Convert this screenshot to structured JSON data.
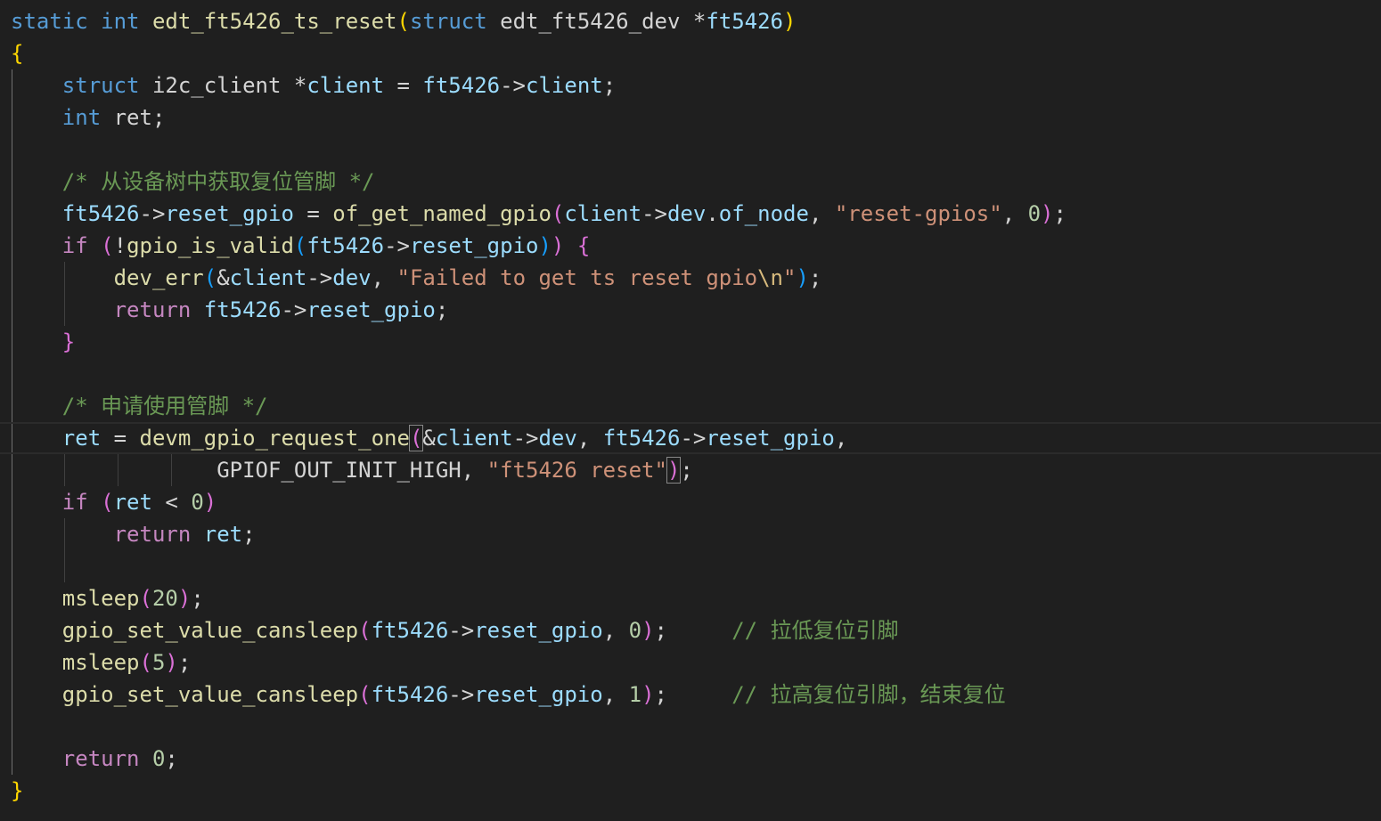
{
  "editor": {
    "theme_background": "#1f1f1f",
    "lines": [
      [
        [
          "k",
          "static"
        ],
        [
          "p",
          " "
        ],
        [
          "k",
          "int"
        ],
        [
          "p",
          " "
        ],
        [
          "f",
          "edt_ft5426_ts_reset"
        ],
        [
          "b1",
          "("
        ],
        [
          "k",
          "struct"
        ],
        [
          "p",
          " edt_ft5426_dev *"
        ],
        [
          "v",
          "ft5426"
        ],
        [
          "b1",
          ")"
        ]
      ],
      [
        [
          "b1",
          "{"
        ]
      ],
      [
        [
          "p",
          "    "
        ],
        [
          "k",
          "struct"
        ],
        [
          "p",
          " i2c_client *"
        ],
        [
          "v",
          "client"
        ],
        [
          "p",
          " = "
        ],
        [
          "v",
          "ft5426"
        ],
        [
          "p",
          "->"
        ],
        [
          "v",
          "client"
        ],
        [
          "p",
          ";"
        ]
      ],
      [
        [
          "p",
          "    "
        ],
        [
          "k",
          "int"
        ],
        [
          "p",
          " ret;"
        ]
      ],
      [],
      [
        [
          "p",
          "    "
        ],
        [
          "cm",
          "/* 从设备树中获取复位管脚 */"
        ]
      ],
      [
        [
          "p",
          "    "
        ],
        [
          "v",
          "ft5426"
        ],
        [
          "p",
          "->"
        ],
        [
          "v",
          "reset_gpio"
        ],
        [
          "p",
          " = "
        ],
        [
          "f",
          "of_get_named_gpio"
        ],
        [
          "b2",
          "("
        ],
        [
          "v",
          "client"
        ],
        [
          "p",
          "->"
        ],
        [
          "v",
          "dev"
        ],
        [
          "p",
          "."
        ],
        [
          "v",
          "of_node"
        ],
        [
          "p",
          ", "
        ],
        [
          "s",
          "\"reset-gpios\""
        ],
        [
          "p",
          ", "
        ],
        [
          "n",
          "0"
        ],
        [
          "b2",
          ")"
        ],
        [
          "p",
          ";"
        ]
      ],
      [
        [
          "p",
          "    "
        ],
        [
          "c",
          "if"
        ],
        [
          "p",
          " "
        ],
        [
          "b2",
          "("
        ],
        [
          "p",
          "!"
        ],
        [
          "f",
          "gpio_is_valid"
        ],
        [
          "b3",
          "("
        ],
        [
          "v",
          "ft5426"
        ],
        [
          "p",
          "->"
        ],
        [
          "v",
          "reset_gpio"
        ],
        [
          "b3",
          ")"
        ],
        [
          "b2",
          ")"
        ],
        [
          "p",
          " "
        ],
        [
          "b2",
          "{"
        ]
      ],
      [
        [
          "p",
          "        "
        ],
        [
          "f",
          "dev_err"
        ],
        [
          "b3",
          "("
        ],
        [
          "p",
          "&"
        ],
        [
          "v",
          "client"
        ],
        [
          "p",
          "->"
        ],
        [
          "v",
          "dev"
        ],
        [
          "p",
          ", "
        ],
        [
          "s",
          "\"Failed to get ts reset gpio"
        ],
        [
          "e",
          "\\n"
        ],
        [
          "s",
          "\""
        ],
        [
          "b3",
          ")"
        ],
        [
          "p",
          ";"
        ]
      ],
      [
        [
          "p",
          "        "
        ],
        [
          "c",
          "return"
        ],
        [
          "p",
          " "
        ],
        [
          "v",
          "ft5426"
        ],
        [
          "p",
          "->"
        ],
        [
          "v",
          "reset_gpio"
        ],
        [
          "p",
          ";"
        ]
      ],
      [
        [
          "p",
          "    "
        ],
        [
          "b2",
          "}"
        ]
      ],
      [],
      [
        [
          "p",
          "    "
        ],
        [
          "cm",
          "/* 申请使用管脚 */"
        ]
      ],
      [
        [
          "p",
          "    "
        ],
        [
          "v",
          "ret"
        ],
        [
          "p",
          " = "
        ],
        [
          "f",
          "devm_gpio_request_one"
        ],
        [
          "b2",
          "(",
          "box"
        ],
        [
          "p",
          "&"
        ],
        [
          "v",
          "client"
        ],
        [
          "p",
          "->"
        ],
        [
          "v",
          "dev"
        ],
        [
          "p",
          ", "
        ],
        [
          "v",
          "ft5426"
        ],
        [
          "p",
          "->"
        ],
        [
          "v",
          "reset_gpio"
        ],
        [
          "p",
          ","
        ]
      ],
      [
        [
          "p",
          "                "
        ],
        [
          "p",
          "GPIOF_OUT_INIT_HIGH"
        ],
        [
          "p",
          ", "
        ],
        [
          "s",
          "\"ft5426 reset\""
        ],
        [
          "b2",
          ")",
          "box"
        ],
        [
          "p",
          ";"
        ]
      ],
      [
        [
          "p",
          "    "
        ],
        [
          "c",
          "if"
        ],
        [
          "p",
          " "
        ],
        [
          "b2",
          "("
        ],
        [
          "v",
          "ret"
        ],
        [
          "p",
          " < "
        ],
        [
          "n",
          "0"
        ],
        [
          "b2",
          ")"
        ]
      ],
      [
        [
          "p",
          "        "
        ],
        [
          "c",
          "return"
        ],
        [
          "p",
          " "
        ],
        [
          "v",
          "ret"
        ],
        [
          "p",
          ";"
        ]
      ],
      [],
      [
        [
          "p",
          "    "
        ],
        [
          "f",
          "msleep"
        ],
        [
          "b2",
          "("
        ],
        [
          "n",
          "20"
        ],
        [
          "b2",
          ")"
        ],
        [
          "p",
          ";"
        ]
      ],
      [
        [
          "p",
          "    "
        ],
        [
          "f",
          "gpio_set_value_cansleep"
        ],
        [
          "b2",
          "("
        ],
        [
          "v",
          "ft5426"
        ],
        [
          "p",
          "->"
        ],
        [
          "v",
          "reset_gpio"
        ],
        [
          "p",
          ", "
        ],
        [
          "n",
          "0"
        ],
        [
          "b2",
          ")"
        ],
        [
          "p",
          ";"
        ],
        [
          "p",
          "     "
        ],
        [
          "cm",
          "// 拉低复位引脚"
        ]
      ],
      [
        [
          "p",
          "    "
        ],
        [
          "f",
          "msleep"
        ],
        [
          "b2",
          "("
        ],
        [
          "n",
          "5"
        ],
        [
          "b2",
          ")"
        ],
        [
          "p",
          ";"
        ]
      ],
      [
        [
          "p",
          "    "
        ],
        [
          "f",
          "gpio_set_value_cansleep"
        ],
        [
          "b2",
          "("
        ],
        [
          "v",
          "ft5426"
        ],
        [
          "p",
          "->"
        ],
        [
          "v",
          "reset_gpio"
        ],
        [
          "p",
          ", "
        ],
        [
          "n",
          "1"
        ],
        [
          "b2",
          ")"
        ],
        [
          "p",
          ";"
        ],
        [
          "p",
          "     "
        ],
        [
          "cm",
          "// 拉高复位引脚，结束复位"
        ]
      ],
      [],
      [
        [
          "p",
          "    "
        ],
        [
          "c",
          "return"
        ],
        [
          "p",
          " "
        ],
        [
          "n",
          "0"
        ],
        [
          "p",
          ";"
        ]
      ],
      [
        [
          "b1",
          "}"
        ]
      ]
    ],
    "current_line_index": 13
  }
}
